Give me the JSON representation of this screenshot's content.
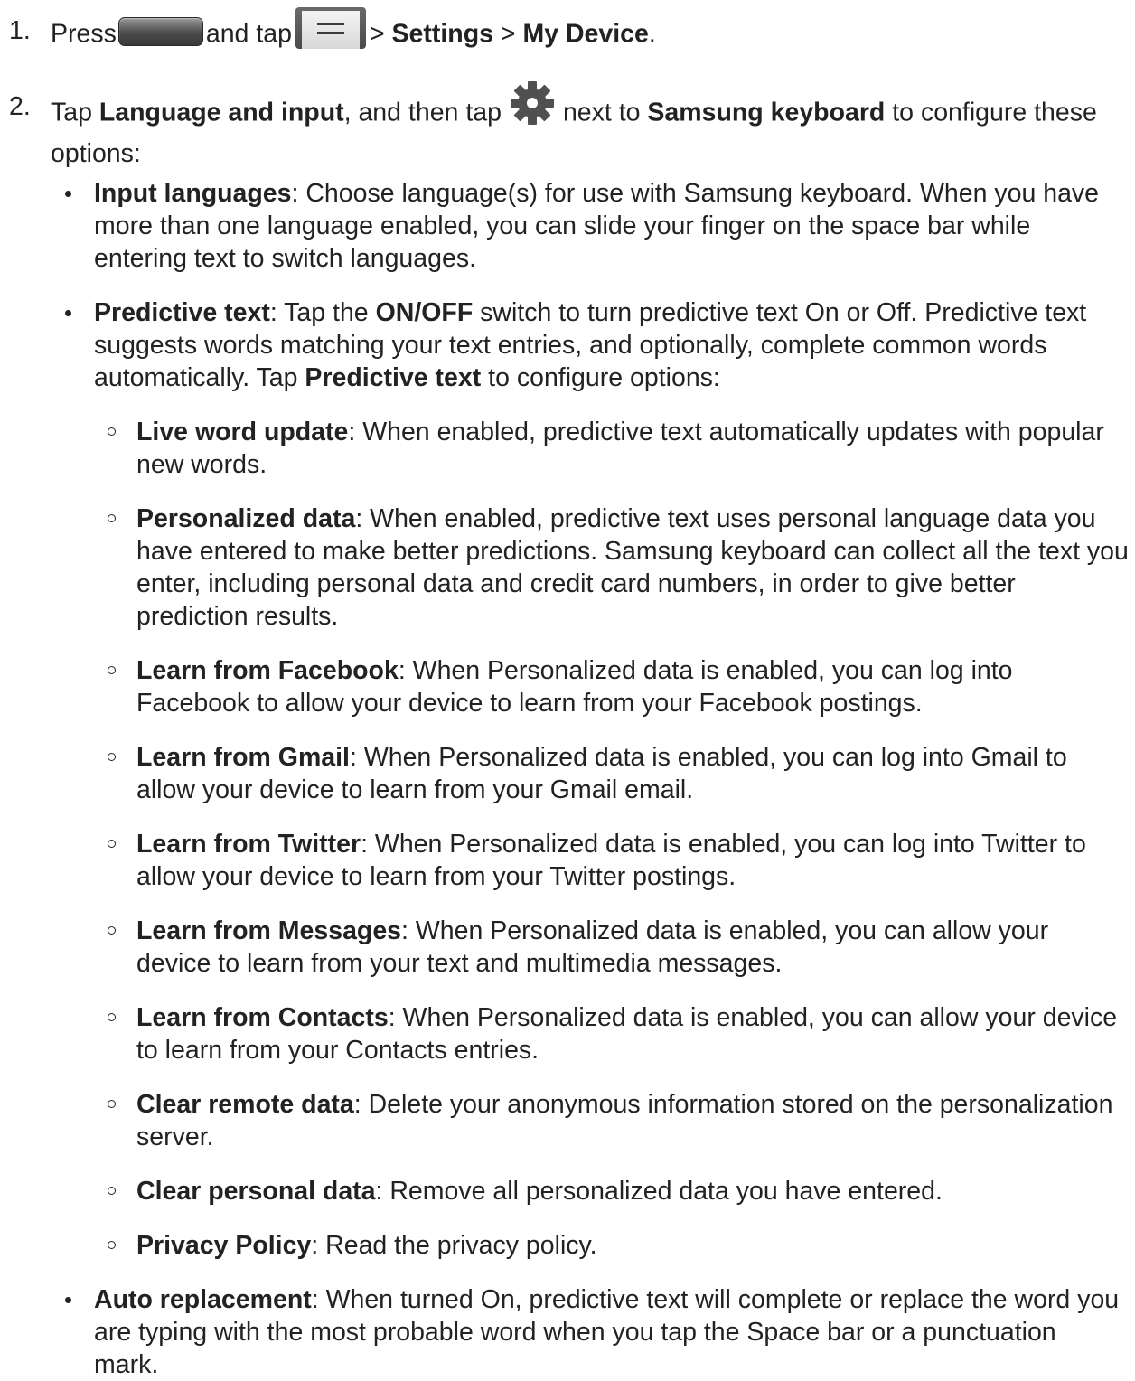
{
  "steps": [
    {
      "number": "1.",
      "press": "Press",
      "and_tap": "and tap",
      "sep1": ">",
      "settings": "Settings",
      "sep2": ">",
      "my_device": "My Device",
      "period": "."
    },
    {
      "number": "2.",
      "tap": "Tap",
      "language_and_input": "Language and input",
      "and_then_tap": ", and then tap",
      "next_to": "next to",
      "samsung_keyboard": "Samsung keyboard",
      "rest": "to configure these options:"
    }
  ],
  "icons": {
    "home": "home-key-icon",
    "menu": "menu-key-icon",
    "settings": "gear-icon"
  },
  "bullets": [
    {
      "term": "Input languages",
      "text": ": Choose language(s) for use with Samsung keyboard. When you have more than one language enabled, you can slide your finger on the space bar while entering text to switch languages."
    },
    {
      "term": "Predictive text",
      "text_a": ": Tap the ",
      "switch": "ON/OFF",
      "text_b": " switch to turn predictive text On or Off. Predictive text suggests words matching your text entries, and optionally, complete common words automatically. Tap ",
      "term2": "Predictive text",
      "text_c": " to configure options:"
    },
    {
      "term": "Auto replacement",
      "text": ": When turned On, predictive text will complete or replace the word you are typing with the most probable word when you tap the Space bar or a punctuation mark."
    }
  ],
  "sub_options": [
    {
      "term": "Live word update",
      "text": ": When enabled, predictive text automatically updates with popular new words."
    },
    {
      "term": "Personalized data",
      "text": ": When enabled, predictive text uses personal language data you have entered to make better predictions. Samsung keyboard can collect all the text you enter, including personal data and credit card numbers, in order to give better prediction results."
    },
    {
      "term": "Learn from Facebook",
      "text": ": When Personalized data is enabled, you can log into Facebook to allow your device to learn from your Facebook postings."
    },
    {
      "term": "Learn from Gmail",
      "text": ": When Personalized data is enabled, you can log into Gmail to allow your device to learn from your Gmail email."
    },
    {
      "term": "Learn from Twitter",
      "text": ": When Personalized data is enabled, you can log into Twitter to allow your device to learn from your Twitter postings."
    },
    {
      "term": "Learn from Messages",
      "text": ": When Personalized data is enabled, you can allow your device to learn from your text and multimedia messages."
    },
    {
      "term": "Learn from Contacts",
      "text": ": When Personalized data is enabled, you can allow your device to learn from your Contacts entries."
    },
    {
      "term": "Clear remote data",
      "text": ": Delete your anonymous information stored on the personalization server."
    },
    {
      "term": "Clear personal data",
      "text": ": Remove all personalized data you have entered."
    },
    {
      "term": "Privacy Policy",
      "text": ": Read the privacy policy."
    }
  ]
}
